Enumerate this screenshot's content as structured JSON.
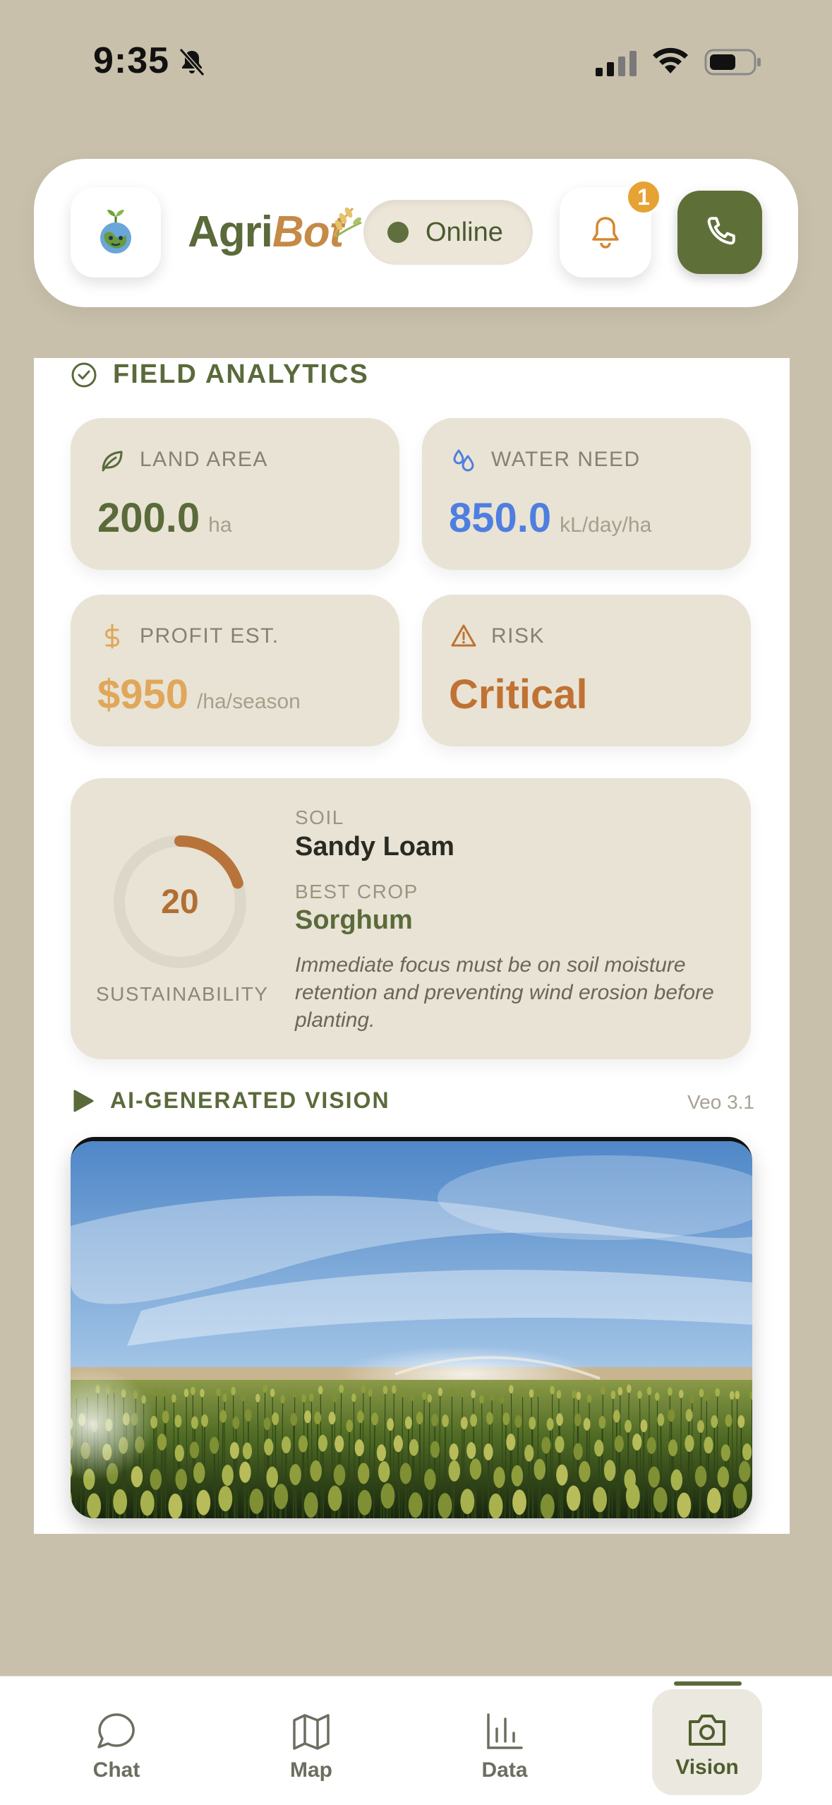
{
  "status_bar": {
    "time": "9:35",
    "icons": [
      "bell-slash-icon",
      "signal-icon",
      "wifi-icon",
      "battery-icon"
    ]
  },
  "header": {
    "brand_part1": "Agri",
    "brand_part2": "Bot",
    "status_label": "Online",
    "notification_count": "1",
    "icons": [
      "globe-seedling-logo",
      "wheat-icon",
      "bell-icon",
      "phone-icon"
    ]
  },
  "field_analytics": {
    "title": "FIELD ANALYTICS",
    "land_area": {
      "label": "LAND AREA",
      "value": "200.0",
      "unit": "ha",
      "icon": "leaf-icon"
    },
    "water_need": {
      "label": "WATER NEED",
      "value": "850.0",
      "unit": "kL/day/ha",
      "icon": "droplets-icon"
    },
    "profit": {
      "label": "PROFIT EST.",
      "value": "$950",
      "unit": "/ha/season",
      "icon": "dollar-icon"
    },
    "risk": {
      "label": "RISK",
      "value": "Critical",
      "icon": "warning-icon"
    },
    "sustainability": {
      "score": "20",
      "score_fraction": 0.2,
      "label": "SUSTAINABILITY",
      "soil_label": "SOIL",
      "soil_value": "Sandy Loam",
      "crop_label": "BEST CROP",
      "crop_value": "Sorghum",
      "note": "Immediate focus must be on soil moisture retention and preventing wind erosion before planting."
    }
  },
  "vision": {
    "title": "AI-GENERATED VISION",
    "model_tag": "Veo 3.1",
    "image_subject": "sorghum field with irrigation sprinkler under blue sky"
  },
  "bottom_nav": {
    "chat": "Chat",
    "map": "Map",
    "data": "Data",
    "vision": "Vision",
    "active": "Vision"
  },
  "colors": {
    "background": "#c8c0ab",
    "olive": "#5a6a3a",
    "card": "#e8e3d4",
    "blue": "#4f7ee0",
    "amber": "#e0a75a",
    "orange": "#bf7233",
    "badge": "#e6a232"
  }
}
